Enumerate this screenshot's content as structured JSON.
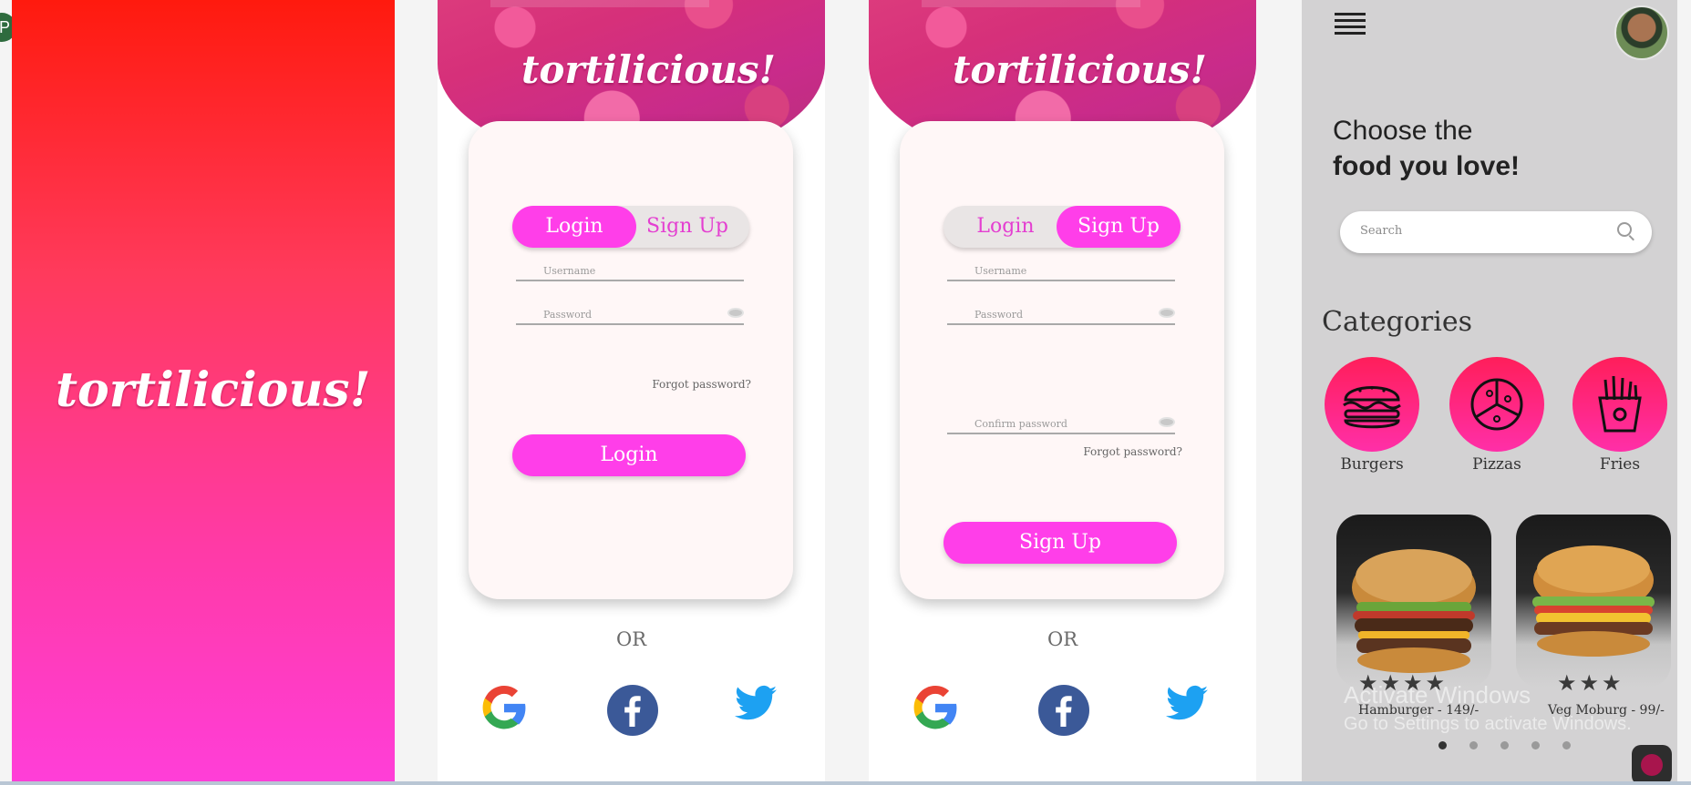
{
  "brand": {
    "name": "tortilicious!"
  },
  "login_screen": {
    "tabs": {
      "login": "Login",
      "signup": "Sign Up"
    },
    "username_placeholder": "Username",
    "password_placeholder": "Password",
    "forgot": "Forgot password?",
    "submit": "Login",
    "or": "OR"
  },
  "signup_screen": {
    "tabs": {
      "login": "Login",
      "signup": "Sign Up"
    },
    "username_placeholder": "Username",
    "password_placeholder": "Password",
    "confirm_placeholder": "Confirm password",
    "forgot": "Forgot password?",
    "submit": "Sign Up",
    "or": "OR"
  },
  "home": {
    "title_line1": "Choose the",
    "title_line2": "food you love!",
    "search_placeholder": "Search",
    "categories_heading": "Categories",
    "categories": [
      {
        "label": "Burgers",
        "icon": "burger-icon"
      },
      {
        "label": "Pizzas",
        "icon": "pizza-icon"
      },
      {
        "label": "Fries",
        "icon": "fries-icon"
      }
    ],
    "items": [
      {
        "name": "Hamburger - 149/-",
        "rating": 4,
        "stars": "★★★★"
      },
      {
        "name": "Veg Moburg - 99/-",
        "rating": 3,
        "stars": "★★★"
      }
    ],
    "carousel_pages": 5,
    "active_page": 1
  },
  "watermark": {
    "line1": "Activate Windows",
    "line2": "Go to Settings to activate Windows."
  },
  "colors": {
    "accent_pink": "#ff3ee9",
    "splash_top": "#ff1a0e",
    "splash_bottom": "#ff3ed8",
    "card_bg": "#fff7f7"
  }
}
